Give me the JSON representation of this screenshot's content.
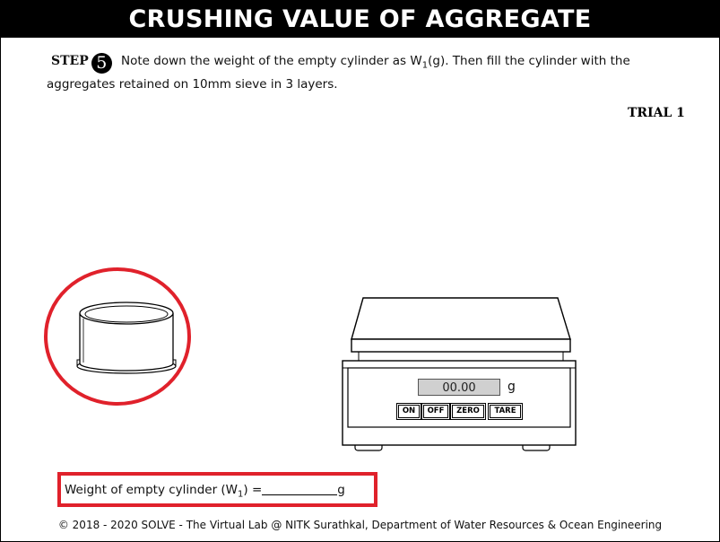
{
  "header": {
    "title": "CRUSHING VALUE OF AGGREGATE"
  },
  "step": {
    "label": "STEP",
    "number": "5",
    "text_part1": "Note down the weight of the empty cylinder as W",
    "subscript": "1",
    "text_part2": "(g). Then fill the cylinder with the aggregates retained on 10mm sieve in 3 layers."
  },
  "trial": {
    "label": "TRIAL 1"
  },
  "scale": {
    "display_value": "00.00",
    "unit": "g",
    "buttons": {
      "on": "ON",
      "off": "OFF",
      "zero": "ZERO",
      "tare": "TARE"
    }
  },
  "result": {
    "label_prefix": "Weight of empty cylinder (W",
    "label_subscript": "1",
    "label_suffix": ") =",
    "unit": "g",
    "value": ""
  },
  "footer": {
    "text": "© 2018 - 2020 SOLVE - The Virtual Lab @ NITK Surathkal, Department of Water Resources & Ocean Engineering"
  },
  "colors": {
    "highlight_red": "#e0212b",
    "header_bg": "#000000",
    "display_bg": "#d0d0d0"
  },
  "icons": {
    "cylinder": "empty-cylinder-icon",
    "scale": "weighing-scale-icon"
  }
}
